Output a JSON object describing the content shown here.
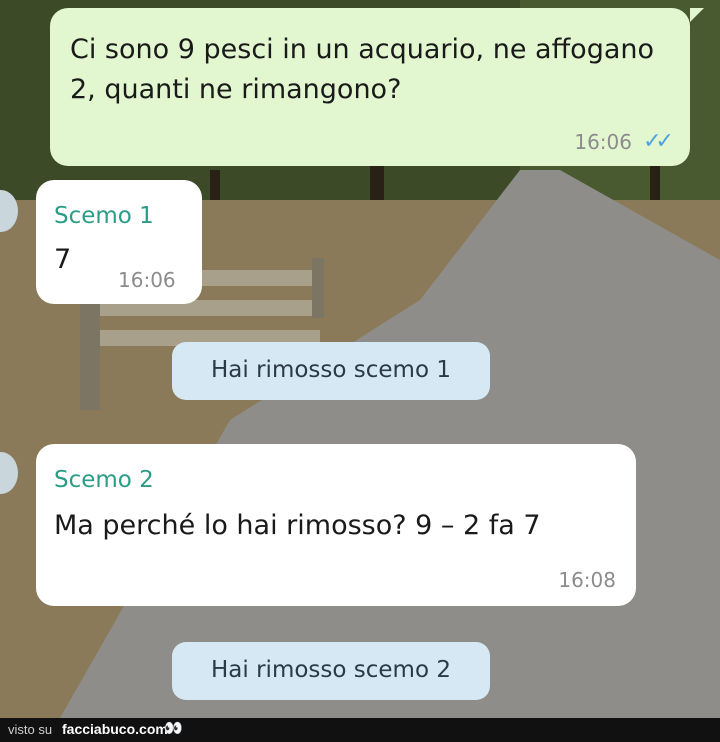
{
  "chat": {
    "outgoing": {
      "text": "Ci sono 9 pesci in un acquario, ne affogano 2, quanti ne rimangono?",
      "time": "16:06",
      "status_icon": "double-check-icon"
    },
    "reply1": {
      "sender": "Scemo 1",
      "text": "7",
      "time": "16:06"
    },
    "system1": "Hai rimosso scemo 1",
    "reply2": {
      "sender": "Scemo 2",
      "text": "Ma perché lo hai rimosso? 9 – 2 fa 7",
      "time": "16:08"
    },
    "system2": "Hai rimosso scemo 2"
  },
  "footer": {
    "prefix": "visto su",
    "site": "facciabuco.com",
    "logo": "eyes-icon"
  },
  "colors": {
    "outgoing": "#e2f6cf",
    "incoming": "#ffffff",
    "system": "#d6e8f3",
    "sender": "#2d9c86",
    "ticks": "#4fa3e0"
  }
}
